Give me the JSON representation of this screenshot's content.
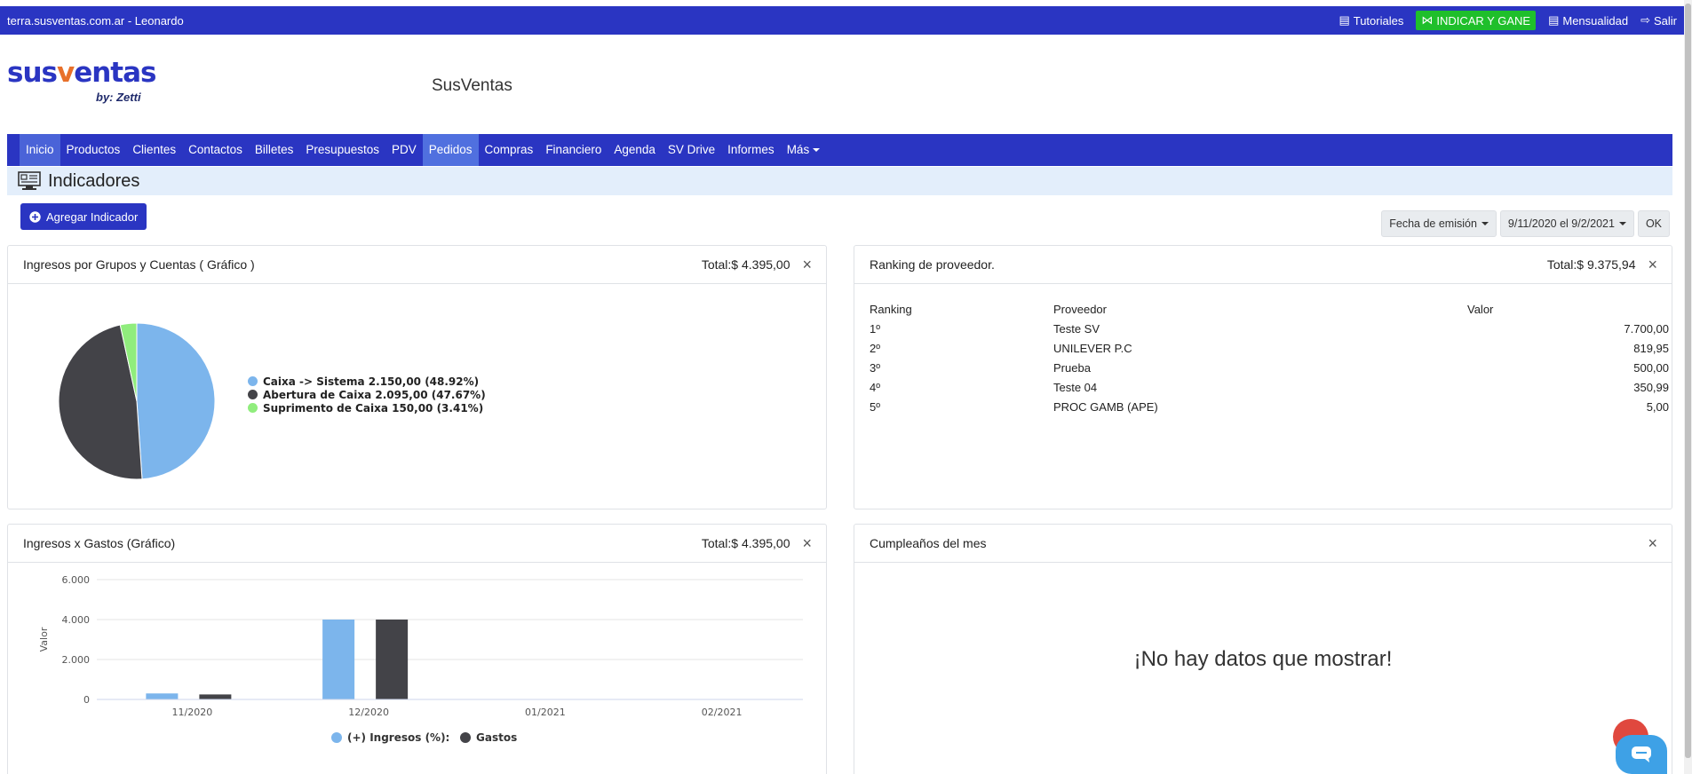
{
  "topbar": {
    "site": "terra.susventas.com.ar - Leonardo",
    "tutoriales": "Tutoriales",
    "indicar": "INDICAR Y GANE",
    "mensualidad": "Mensualidad",
    "salir": "Salir"
  },
  "header": {
    "brand_sus": "sus",
    "brand_v": "v",
    "brand_entas": "entas",
    "by": "by: Zetti",
    "title": "SusVentas"
  },
  "nav": {
    "items": [
      "Inicio",
      "Productos",
      "Clientes",
      "Contactos",
      "Billetes",
      "Presupuestos",
      "PDV",
      "Pedidos",
      "Compras",
      "Financiero",
      "Agenda",
      "SV Drive",
      "Informes",
      "Más"
    ]
  },
  "page": {
    "title": "Indicadores",
    "add_button": "Agregar Indicador",
    "filter_field": "Fecha de emisión",
    "filter_range": "9/11/2020 el 9/2/2021",
    "ok": "OK"
  },
  "card_ingresos": {
    "title": "Ingresos por Grupos y Cuentas ( Gráfico )",
    "total": "Total:$ 4.395,00",
    "close": "×"
  },
  "card_ranking": {
    "title": "Ranking de proveedor.",
    "total": "Total:$ 9.375,94",
    "close": "×",
    "columns": [
      "Ranking",
      "Proveedor",
      "Valor"
    ],
    "rows": [
      {
        "rank": "1º",
        "proveedor": "Teste SV",
        "valor": "7.700,00"
      },
      {
        "rank": "2º",
        "proveedor": "UNILEVER P.C",
        "valor": "819,95"
      },
      {
        "rank": "3º",
        "proveedor": "Prueba",
        "valor": "500,00"
      },
      {
        "rank": "4º",
        "proveedor": "Teste 04",
        "valor": "350,99"
      },
      {
        "rank": "5º",
        "proveedor": "PROC GAMB (APE)",
        "valor": "5,00"
      }
    ]
  },
  "card_gastos": {
    "title": "Ingresos x Gastos (Gráfico)",
    "total": "Total:$ 4.395,00",
    "close": "×"
  },
  "card_cumple": {
    "title": "Cumpleaños del mes",
    "close": "×",
    "empty": "¡No hay datos que mostrar!"
  },
  "colors": {
    "primary": "#2a35c2",
    "promo": "#1fbf2b",
    "series_blue": "#7cb5ec",
    "series_dark": "#434348",
    "series_green": "#90ed7d"
  },
  "chart_data": [
    {
      "type": "pie",
      "labels": [
        "Caixa -> Sistema 2.150,00 (48.92%)",
        "Abertura de Caixa 2.095,00 (47.67%)",
        "Suprimento de Caixa 150,00 (3.41%)"
      ],
      "values": [
        2150,
        2095,
        150
      ],
      "colors": [
        "#7cb5ec",
        "#434348",
        "#90ed7d"
      ],
      "legend": "right"
    },
    {
      "type": "bar",
      "categories": [
        "11/2020",
        "12/2020",
        "01/2021",
        "02/2021"
      ],
      "series": [
        {
          "name": "(+) Ingresos (%):",
          "values": [
            300,
            4000,
            0,
            0
          ],
          "color": "#7cb5ec"
        },
        {
          "name": "Gastos",
          "values": [
            250,
            4000,
            0,
            0
          ],
          "color": "#434348"
        }
      ],
      "ylabel": "Valor",
      "yticks": [
        "0",
        "2.000",
        "4.000",
        "6.000"
      ],
      "ylim": [
        0,
        6000
      ],
      "grid": true,
      "legend": "bottom"
    }
  ]
}
